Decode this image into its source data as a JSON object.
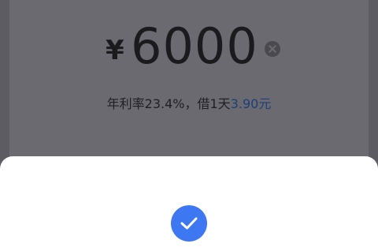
{
  "loan": {
    "currency_symbol": "¥",
    "amount": "6000",
    "rate_prefix": "年利率23.4%，借1天",
    "daily_cost": "3.90元"
  },
  "icons": {
    "clear": "clear-icon",
    "success": "check-icon"
  },
  "colors": {
    "accent": "#3d77f2",
    "overlay": "#6b6a70",
    "sheet": "#ffffff"
  }
}
